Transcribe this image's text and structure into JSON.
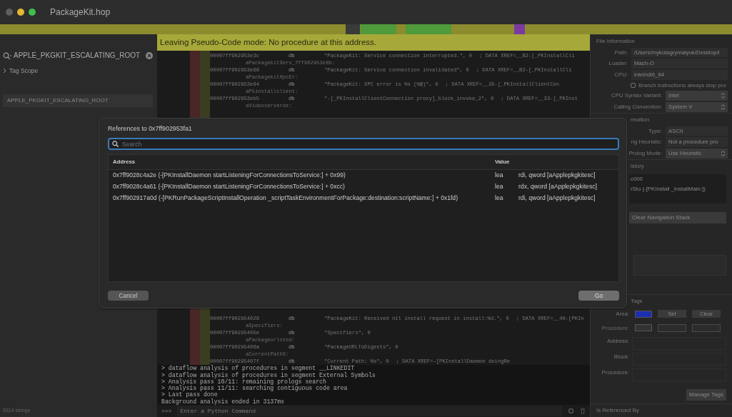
{
  "window": {
    "title": "PackageKit.hop"
  },
  "sidebar": {
    "search": {
      "value": "APPLE_PKGKIT_ESCALATING_ROOT"
    },
    "scope": {
      "label": "Tag Scope",
      "expanded": false
    },
    "items": [
      {
        "label": "APPLE_PKGKIT_ESCALATING_ROOT"
      }
    ],
    "footer": "5314 strings"
  },
  "banner": "Leaving Pseudo-Code mode: No procedure at this address.",
  "code_top": [
    {
      "address": "00007ff902953e3c",
      "directive": "db",
      "operand": "\"PackageKit: Service connection interrupted.\", 0",
      "comment": "; DATA XREF=__B2-[_PKInstallCli",
      "label": "aPackagekitServ_7ff902953e8b:"
    },
    {
      "address": "00007ff902953e68",
      "directive": "db",
      "operand": "\"PackageKit: Service connection invalidated\", 0",
      "comment": "; DATA XREF=__B2-[_PKInstallCli",
      "label": "aPackagekitXpcEr:"
    },
    {
      "address": "00007ff902953e94",
      "directive": "db",
      "operand": "\"PackageKit: XPC error is %s (%@)\", 0",
      "comment": "; DATA XREF=__35-[_PKInstallClientCon",
      "label": "aPkinstallclient:"
    },
    {
      "address": "00007ff902953eb5",
      "directive": "db",
      "operand": "\"-[_PKInstallClientConnection proxy]_block_invoke_2\", 0",
      "comment": "; DATA XREF=__33-[_PKInst",
      "label": "aVideoserverdz:"
    }
  ],
  "code_bottom": [
    {
      "address": "00007ff902954028",
      "directive": "db",
      "operand": "\"PackageKit: Received nil install request in install:%d.\", 0",
      "comment": "; DATA XREF=__40-[PKIn",
      "label": "aSpecifiers:"
    },
    {
      "address": "00007ff90295405e",
      "directive": "db",
      "operand": "\"Specifiers\", 0",
      "label": "aPackageurlstod:"
    },
    {
      "address": "00007ff90295406a",
      "directive": "db",
      "operand": "\"PackageURLToDigests\", 0",
      "label": "aCurrentPathS:"
    },
    {
      "address": "00007ff90295407f",
      "directive": "db",
      "operand": "\"Current Path: %s\", 0",
      "comment": "; DATA XREF=-[PKInstallDaemon doingRe"
    }
  ],
  "console": {
    "lines": [
      "> dataflow analysis of procedures in segment __LINKEDIT",
      "> dataflow analysis of procedures in segment External Symbols",
      "> Analysis pass 10/11: remaining prologs search",
      "> Analysis pass 11/11: searching contiguous code area",
      "> Last pass done",
      "Background analysis ended in 3137ms"
    ],
    "prompt": ">>>",
    "placeholder": "Enter a Python Command"
  },
  "inspector": {
    "rows": [
      {
        "kind": "header",
        "text": "File Information"
      },
      {
        "kind": "field",
        "label": "Path:",
        "value": "/Users/mykolagrymalyuk/Desktop/l"
      },
      {
        "kind": "field",
        "label": "Loader:",
        "value": "Mach-O"
      },
      {
        "kind": "field",
        "label": "CPU:",
        "value": "intel/x86_64"
      },
      {
        "kind": "check",
        "label": "Branch instructions always stop pro",
        "checked": false
      },
      {
        "kind": "select",
        "label": "CPU Syntax Variant:",
        "value": "Intel"
      },
      {
        "kind": "select",
        "label": "Calling Convention:",
        "value": "System V"
      },
      {
        "kind": "header",
        "text": "rmation"
      },
      {
        "kind": "field",
        "label": "Type:",
        "value": "ASCII"
      },
      {
        "kind": "field",
        "label": "ng Heuristic:",
        "value": "Not a procedure pro"
      },
      {
        "kind": "select",
        "label": "Prolog Mode:",
        "value": "Use Heuristic"
      },
      {
        "kind": "header",
        "text": "istory"
      },
      {
        "kind": "list",
        "items": [
          "c000",
          "rSto (-[PKInstall _installMain:])"
        ]
      },
      {
        "kind": "button",
        "text": "Clear Navigation Stack"
      },
      {
        "kind": "box"
      },
      {
        "kind": "header",
        "text": "Tags"
      },
      {
        "kind": "tagrow",
        "label": "Area:",
        "color": "#1c2fb0",
        "buttons": [
          "Set",
          "Clear"
        ]
      },
      {
        "kind": "tagrow",
        "label": "Procedure:",
        "disabled": true
      },
      {
        "kind": "area",
        "label": "Address:"
      },
      {
        "kind": "area",
        "label": "Block:"
      },
      {
        "kind": "area",
        "label": "Procedure:"
      },
      {
        "kind": "action",
        "text": "Manage Tags"
      },
      {
        "kind": "footer",
        "text": "Is Referenced By"
      }
    ]
  },
  "dialog": {
    "title": "References to 0x7ff902953fa1",
    "search": {
      "placeholder": "Search"
    },
    "columns": [
      "Address",
      "Value"
    ],
    "rows": [
      {
        "address": "0x7ff9028c4a2e (-[PKInstallDaemon startListeningForConnectionsToService:] + 0x99)",
        "mnemonic": "lea",
        "operands": "rdi, qword [aApplepkgkitesc]"
      },
      {
        "address": "0x7ff9028c4a61 (-[PKInstallDaemon startListeningForConnectionsToService:] + 0xcc)",
        "mnemonic": "lea",
        "operands": "rdx, qword [aApplepkgkitesc]"
      },
      {
        "address": "0x7ff902917a0d (-[PKRunPackageScriptInstallOperation _scriptTaskEnvironmentForPackage:destination:scriptName:] + 0x1fd)",
        "mnemonic": "lea",
        "operands": "rdi, qword [aApplepkgkitesc]"
      }
    ],
    "buttons": [
      {
        "text": "Cancel",
        "kind": "cancel"
      },
      {
        "text": "Go",
        "kind": "default"
      }
    ]
  }
}
